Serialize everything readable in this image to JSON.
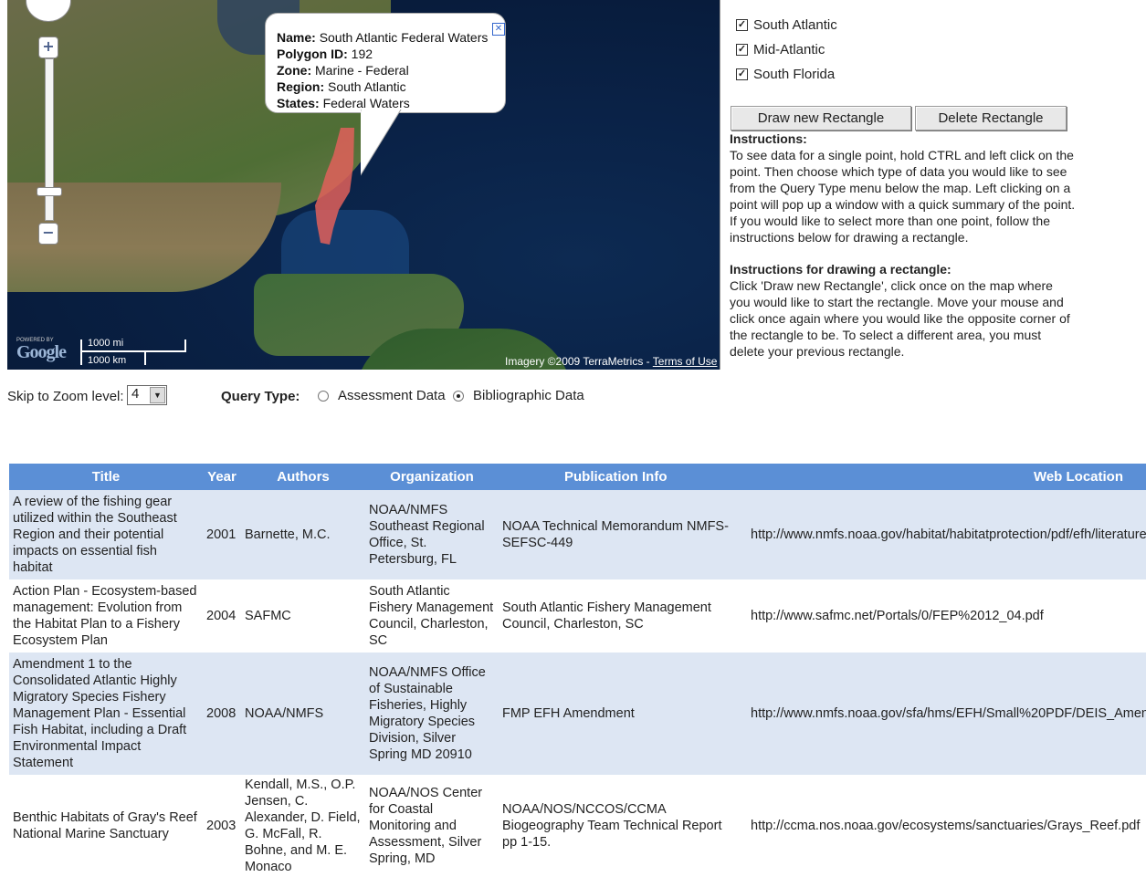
{
  "map": {
    "info_window": {
      "name_label": "Name:",
      "name_value": "South Atlantic Federal Waters",
      "polygon_label": "Polygon ID:",
      "polygon_value": "192",
      "zone_label": "Zone:",
      "zone_value": "Marine - Federal",
      "region_label": "Region:",
      "region_value": "South Atlantic",
      "states_label": "States:",
      "states_value": "Federal Waters"
    },
    "zoom_in": "+",
    "zoom_out": "−",
    "powered_by": "POWERED BY",
    "google_logo": "Google",
    "scale_mi": "1000 mi",
    "scale_km": "1000 km",
    "imagery": "Imagery ©2009 TerraMetrics - ",
    "terms": "Terms of Use"
  },
  "regions": [
    {
      "label": "South Atlantic",
      "checked": true
    },
    {
      "label": "Mid-Atlantic",
      "checked": true
    },
    {
      "label": "South Florida",
      "checked": true
    }
  ],
  "buttons": {
    "draw": "Draw new Rectangle",
    "delete": "Delete Rectangle"
  },
  "instructions": {
    "heading": "Instructions:",
    "body": "To see data for a single point, hold CTRL and left click on the point.  Then choose which type of data you would like to see from the Query Type menu below the map.  Left clicking on a point will pop up a window with a quick summary of the point.  If you would like to select more than one point, follow the instructions below for drawing a rectangle.",
    "rect_heading": "Instructions for drawing a rectangle:",
    "rect_body": "Click 'Draw new Rectangle', click once on the map where you would like to start the rectangle. Move your mouse and click once again where you would like the opposite corner of the rectangle to be.  To select a different area, you must delete your previous rectangle."
  },
  "controls": {
    "zoom_label": "Skip to Zoom level:",
    "zoom_value": "4",
    "query_label": "Query Type:",
    "query_options": [
      "Assessment Data",
      "Bibliographic Data"
    ],
    "query_selected": "Bibliographic Data"
  },
  "table": {
    "headers": [
      "Title",
      "Year",
      "Authors",
      "Organization",
      "Publication Info",
      "Web Location"
    ],
    "rows": [
      {
        "title": "A review of the fishing gear utilized within the Southeast Region and their potential impacts on essential fish habitat",
        "year": "2001",
        "authors": "Barnette, M.C.",
        "org": "NOAA/NMFS Southeast Regional Office, St. Petersburg, FL",
        "pub": "NOAA Technical Memorandum NMFS-SEFSC-449",
        "web": "http://www.nmfs.noaa.gov/habitat/habitatprotection/pdf/efh/literature/"
      },
      {
        "title": "Action Plan - Ecosystem-based management: Evolution from the Habitat Plan to a Fishery Ecosystem Plan",
        "year": "2004",
        "authors": "SAFMC",
        "org": "South Atlantic Fishery Management Council, Charleston, SC",
        "pub": "South Atlantic Fishery Management Council, Charleston, SC",
        "web": "http://www.safmc.net/Portals/0/FEP%2012_04.pdf"
      },
      {
        "title": "Amendment 1 to the Consolidated Atlantic Highly Migratory Species Fishery Management Plan - Essential Fish Habitat, including a Draft Environmental Impact Statement",
        "year": "2008",
        "authors": "NOAA/NMFS",
        "org": "NOAA/NMFS Office of Sustainable Fisheries, Highly Migratory Species Division, Silver Spring MD 20910",
        "pub": "FMP EFH Amendment",
        "web": "http://www.nmfs.noaa.gov/sfa/hms/EFH/Small%20PDF/DEIS_Amen"
      },
      {
        "title": "Benthic Habitats of Gray's Reef National Marine Sanctuary",
        "year": "2003",
        "authors": "Kendall, M.S., O.P. Jensen, C. Alexander, D. Field, G. McFall, R. Bohne, and M. E. Monaco",
        "org": "NOAA/NOS Center for Coastal Monitoring and Assessment, Silver Spring, MD",
        "pub": "NOAA/NOS/NCCOS/CCMA Biogeography Team Technical Report pp 1-15.",
        "web": "http://ccma.nos.noaa.gov/ecosystems/sanctuaries/Grays_Reef.pdf"
      }
    ]
  }
}
